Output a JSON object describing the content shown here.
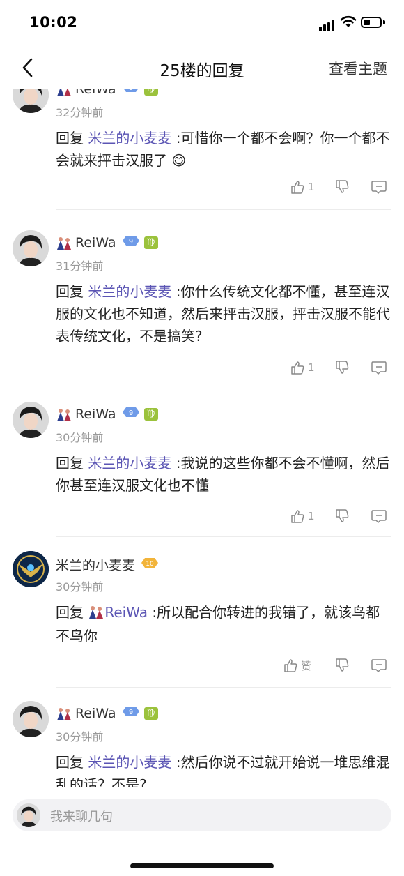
{
  "status_bar": {
    "time": "10:02"
  },
  "nav": {
    "title": "25楼的回复",
    "topic_label": "查看主题"
  },
  "posts": [
    {
      "author": "ReiWa",
      "level": "9",
      "zodiac": "♍",
      "time": "32分钟前",
      "reply_prefix": "回复",
      "reply_to": "米兰的小麦麦",
      "text": " :可惜你一个都不会啊？你一个都不会就来抨击汉服了 😋",
      "likes": "1"
    },
    {
      "author": "ReiWa",
      "level": "9",
      "zodiac": "♍",
      "time": "31分钟前",
      "reply_prefix": "回复",
      "reply_to": "米兰的小麦麦",
      "text": " :你什么传统文化都不懂，甚至连汉服的文化也不知道，然后来抨击汉服，抨击汉服不能代表传统文化，不是搞笑?",
      "likes": "1"
    },
    {
      "author": "ReiWa",
      "level": "9",
      "zodiac": "♍",
      "time": "30分钟前",
      "reply_prefix": "回复",
      "reply_to": "米兰的小麦麦",
      "text": " :我说的这些你都不会不懂啊，然后你甚至连汉服文化也不懂",
      "likes": "1"
    },
    {
      "author": "米兰的小麦麦",
      "level": "10",
      "time": "30分钟前",
      "reply_prefix": "回复",
      "reply_to": "ReiWa",
      "text": " :所以配合你转进的我错了，就该鸟都不鸟你",
      "likes": "赞"
    },
    {
      "author": "ReiWa",
      "level": "9",
      "zodiac": "♍",
      "time": "30分钟前",
      "reply_prefix": "回复",
      "reply_to": "米兰的小麦麦",
      "text": " :然后你说不过就开始说一堆思维混乱的话？不是?",
      "likes": ""
    }
  ],
  "reply_bar": {
    "placeholder": "我来聊几句"
  },
  "colors": {
    "link": "#5b55b4",
    "level_blue": "#6f9be8",
    "level_gold": "#f2b43a"
  }
}
